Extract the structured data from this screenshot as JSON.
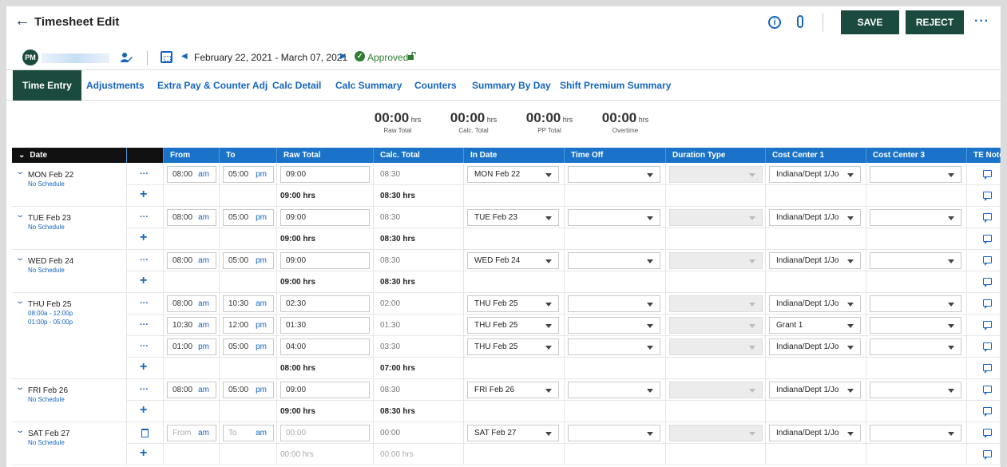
{
  "header": {
    "back_icon": "arrow-left-icon",
    "title": "Timesheet Edit",
    "save_label": "SAVE",
    "reject_label": "REJECT",
    "more_label": "···"
  },
  "employee": {
    "initials": "PM",
    "period": "February 22, 2021 - March 07, 2021",
    "status": "Approved"
  },
  "tabs": [
    "Time Entry",
    "Adjustments",
    "Extra Pay & Counter Adj",
    "Calc Detail",
    "Calc Summary",
    "Counters",
    "Summary By Day",
    "Shift Premium Summary"
  ],
  "totals": [
    {
      "value": "00:00",
      "unit": "hrs",
      "label": "Raw Total"
    },
    {
      "value": "00:00",
      "unit": "hrs",
      "label": "Calc. Total"
    },
    {
      "value": "00:00",
      "unit": "hrs",
      "label": "PP Total"
    },
    {
      "value": "00:00",
      "unit": "hrs",
      "label": "Overtime"
    }
  ],
  "columns": [
    "Date",
    "From",
    "To",
    "Raw Total",
    "Calc. Total",
    "In Date",
    "Time Off",
    "Duration Type",
    "Cost Center 1",
    "Cost Center 3",
    "TE Notes"
  ],
  "days": [
    {
      "name": "MON Feb 22",
      "sub": [
        "No Schedule"
      ],
      "entries": [
        {
          "from": "08:00",
          "from_ap": "am",
          "to": "05:00",
          "to_ap": "pm",
          "raw": "09:00",
          "calc": "08:30",
          "in_date": "MON Feb 22",
          "cc1": "Indiana/Dept 1/Jo"
        }
      ],
      "raw_sum": "09:00 hrs",
      "calc_sum": "08:30 hrs"
    },
    {
      "name": "TUE Feb 23",
      "sub": [
        "No Schedule"
      ],
      "entries": [
        {
          "from": "08:00",
          "from_ap": "am",
          "to": "05:00",
          "to_ap": "pm",
          "raw": "09:00",
          "calc": "08:30",
          "in_date": "TUE Feb 23",
          "cc1": "Indiana/Dept 1/Jo"
        }
      ],
      "raw_sum": "09:00 hrs",
      "calc_sum": "08:30 hrs"
    },
    {
      "name": "WED Feb 24",
      "sub": [
        "No Schedule"
      ],
      "entries": [
        {
          "from": "08:00",
          "from_ap": "am",
          "to": "05:00",
          "to_ap": "pm",
          "raw": "09:00",
          "calc": "08:30",
          "in_date": "WED Feb 24",
          "cc1": "Indiana/Dept 1/Jo"
        }
      ],
      "raw_sum": "09:00 hrs",
      "calc_sum": "08:30 hrs"
    },
    {
      "name": "THU Feb 25",
      "sub": [
        "08:00a - 12:00p",
        "01:00p - 05:00p"
      ],
      "entries": [
        {
          "from": "08:00",
          "from_ap": "am",
          "to": "10:30",
          "to_ap": "am",
          "raw": "02:30",
          "calc": "02:00",
          "in_date": "THU Feb 25",
          "cc1": "Indiana/Dept 1/Jo"
        },
        {
          "from": "10:30",
          "from_ap": "am",
          "to": "12:00",
          "to_ap": "pm",
          "raw": "01:30",
          "calc": "01:30",
          "in_date": "THU Feb 25",
          "cc1": "Grant 1"
        },
        {
          "from": "01:00",
          "from_ap": "pm",
          "to": "05:00",
          "to_ap": "pm",
          "raw": "04:00",
          "calc": "03:30",
          "in_date": "THU Feb 25",
          "cc1": "Indiana/Dept 1/Jo"
        }
      ],
      "raw_sum": "08:00 hrs",
      "calc_sum": "07:00 hrs"
    },
    {
      "name": "FRI Feb 26",
      "sub": [
        "No Schedule"
      ],
      "entries": [
        {
          "from": "08:00",
          "from_ap": "am",
          "to": "05:00",
          "to_ap": "pm",
          "raw": "09:00",
          "calc": "08:30",
          "in_date": "FRI Feb 26",
          "cc1": "Indiana/Dept 1/Jo"
        }
      ],
      "raw_sum": "09:00 hrs",
      "calc_sum": "08:30 hrs"
    },
    {
      "name": "SAT Feb 27",
      "sub": [
        "No Schedule"
      ],
      "empty": true,
      "entries": [
        {
          "from": "From",
          "from_ap": "am",
          "to": "To",
          "to_ap": "am",
          "raw": "00:00",
          "calc": "00:00",
          "in_date": "SAT Feb 27",
          "cc1": "Indiana/Dept 1/Jo"
        }
      ],
      "raw_sum": "00:00 hrs",
      "calc_sum": "00:00 hrs"
    }
  ]
}
